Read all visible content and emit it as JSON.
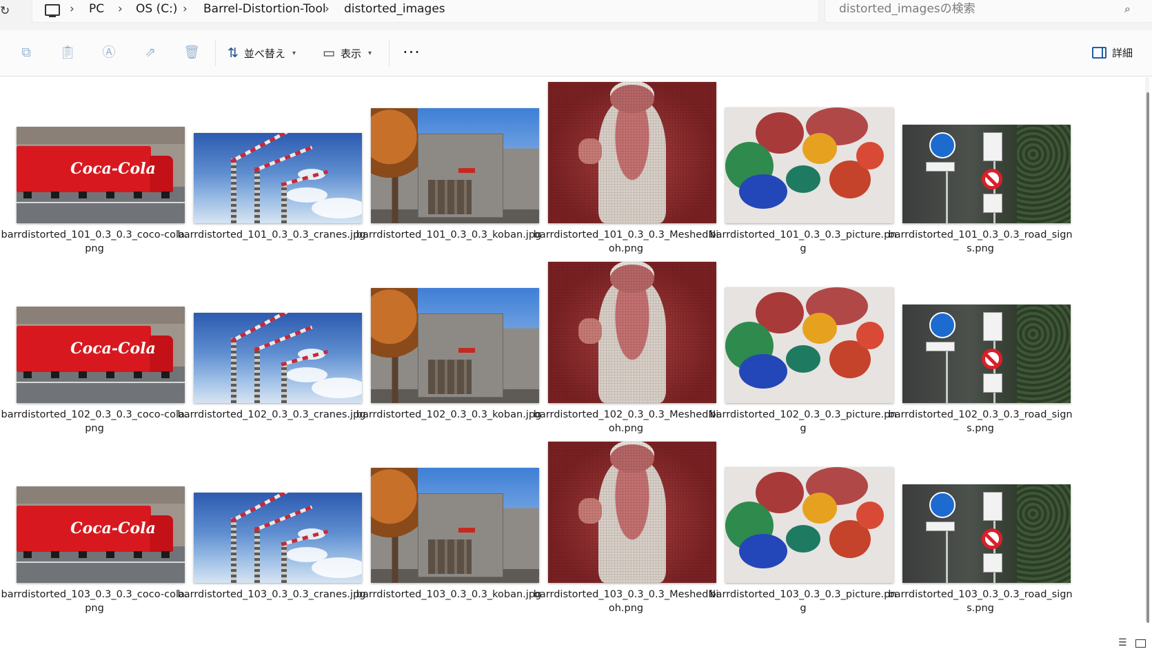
{
  "address_bar": {
    "crumbs": [
      "PC",
      "OS (C:)",
      "Barrel-Distortion-Tool",
      "distorted_images"
    ],
    "separator": "›",
    "refresh_icon": "refresh-icon",
    "pc_icon": "computer-icon"
  },
  "search": {
    "placeholder": "distorted_imagesの検索",
    "icon": "search-icon"
  },
  "toolbar": {
    "disabled_icons": [
      "copy-icon",
      "paste-icon",
      "rename-icon",
      "share-icon",
      "delete-icon"
    ],
    "sort_label": "並べ替え",
    "view_label": "表示",
    "more_label": "···",
    "details_label": "詳細"
  },
  "files": {
    "rows": [
      {
        "names": [
          "barrdistorted_101_0.3_0.3_coco-cola.png",
          "barrdistorted_101_0.3_0.3_cranes.jpg",
          "barrdistorted_101_0.3_0.3_koban.jpg",
          "barrdistorted_101_0.3_0.3_MeshedNioh.png",
          "barrdistorted_101_0.3_0.3_picture.png",
          "barrdistorted_101_0.3_0.3_road_signs.png"
        ]
      },
      {
        "names": [
          "barrdistorted_102_0.3_0.3_coco-cola.png",
          "barrdistorted_102_0.3_0.3_cranes.jpg",
          "barrdistorted_102_0.3_0.3_koban.jpg",
          "barrdistorted_102_0.3_0.3_MeshedNioh.png",
          "barrdistorted_102_0.3_0.3_picture.png",
          "barrdistorted_102_0.3_0.3_road_signs.png"
        ]
      },
      {
        "names": [
          "barrdistorted_103_0.3_0.3_coco-cola.png",
          "barrdistorted_103_0.3_0.3_cranes.jpg",
          "barrdistorted_103_0.3_0.3_koban.jpg",
          "barrdistorted_103_0.3_0.3_MeshedNioh.png",
          "barrdistorted_103_0.3_0.3_picture.png",
          "barrdistorted_103_0.3_0.3_road_signs.png"
        ]
      }
    ],
    "thumb_kinds": [
      "coke",
      "cranes",
      "koban",
      "nioh",
      "picture",
      "road"
    ]
  },
  "colors": {
    "accent": "#1f5fa8",
    "disabled_icon": "#9ab6d3"
  }
}
